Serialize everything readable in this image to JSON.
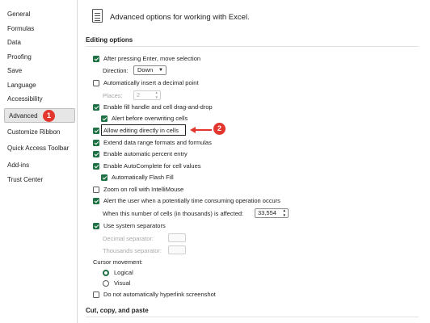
{
  "sidebar": {
    "items": [
      {
        "label": "General"
      },
      {
        "label": "Formulas"
      },
      {
        "label": "Data"
      },
      {
        "label": "Proofing"
      },
      {
        "label": "Save"
      },
      {
        "label": "Language"
      },
      {
        "label": "Accessibility"
      },
      {
        "label": "Advanced"
      },
      {
        "label": "Customize Ribbon"
      },
      {
        "label": "Quick Access Toolbar"
      },
      {
        "label": "Add-ins"
      },
      {
        "label": "Trust Center"
      }
    ],
    "active_item": "Advanced"
  },
  "header": {
    "icon": "options-page-icon",
    "title": "Advanced options for working with Excel."
  },
  "sections": {
    "editing_options": "Editing options",
    "cut_copy_paste": "Cut, copy, and paste"
  },
  "editing": {
    "after_enter": {
      "label": "After pressing Enter, move selection",
      "checked": true
    },
    "direction": {
      "label": "Direction:",
      "value": "Down"
    },
    "decimal_point": {
      "label": "Automatically insert a decimal point",
      "checked": false
    },
    "places": {
      "label": "Places:",
      "value": "2"
    },
    "fill_handle": {
      "label": "Enable fill handle and cell drag-and-drop",
      "checked": true
    },
    "alert_overwrite": {
      "label": "Alert before overwriting cells",
      "checked": true
    },
    "allow_editing": {
      "label": "Allow editing directly in cells",
      "checked": true
    },
    "extend_formats": {
      "label": "Extend data range formats and formulas",
      "checked": true
    },
    "percent_entry": {
      "label": "Enable automatic percent entry",
      "checked": true
    },
    "autocomplete": {
      "label": "Enable AutoComplete for cell values",
      "checked": true
    },
    "flash_fill": {
      "label": "Automatically Flash Fill",
      "checked": true
    },
    "zoom_roll": {
      "label": "Zoom on roll with IntelliMouse",
      "checked": false
    },
    "alert_time": {
      "label": "Alert the user when a potentially time consuming operation occurs",
      "checked": true
    },
    "cells_affected": {
      "label": "When this number of cells (in thousands) is affected:",
      "value": "33,554"
    },
    "system_separators": {
      "label": "Use system separators",
      "checked": true
    },
    "decimal_separator": {
      "label": "Decimal separator:"
    },
    "thousands_separator": {
      "label": "Thousands separator:"
    },
    "cursor_movement": {
      "label": "Cursor movement:"
    },
    "cursor_logical": {
      "label": "Logical",
      "selected": true
    },
    "cursor_visual": {
      "label": "Visual",
      "selected": false
    },
    "no_hyperlink": {
      "label": "Do not automatically hyperlink screenshot",
      "checked": false
    }
  },
  "annotations": {
    "callout_1": "1",
    "callout_2": "2"
  },
  "colors": {
    "accent_green": "#1e7145",
    "callout_red": "#e2362f"
  }
}
